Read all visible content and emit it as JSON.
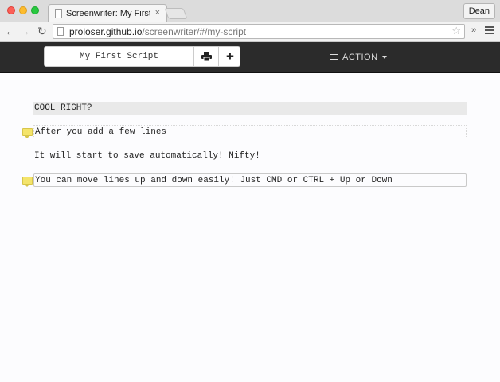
{
  "browser": {
    "tab_title": "Screenwriter: My First Script",
    "tab_close": "×",
    "profile_name": "Dean",
    "url_host": "proloser.github.io",
    "url_path": "/screenwriter/#/my-script",
    "nav_back": "←",
    "nav_forward": "→",
    "nav_reload": "↻",
    "star": "☆",
    "extensions": "»"
  },
  "app": {
    "script_title": "My First Script",
    "add_label": "+",
    "action_label": "ACTION"
  },
  "script": {
    "lines": [
      {
        "type": "scene",
        "text": "COOL RIGHT?",
        "note": false
      },
      {
        "type": "action",
        "text": "After you add a few lines",
        "note": true
      },
      {
        "type": "action",
        "text": "It will start to save automatically! Nifty!",
        "note": false
      },
      {
        "type": "action",
        "text": "You can move lines up and down easily! Just CMD or CTRL + Up or Down",
        "note": true,
        "active": true
      }
    ]
  },
  "colors": {
    "header_bg": "#2b2b2b",
    "scene_bg": "#e9e9e9",
    "note_yellow": "#f4e46b"
  }
}
